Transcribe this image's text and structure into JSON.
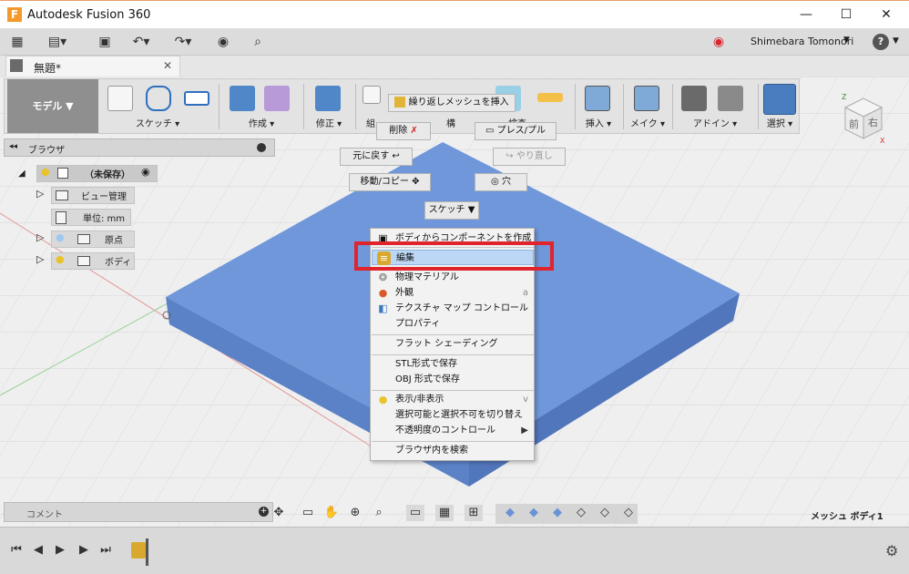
{
  "window": {
    "title": "Autodesk Fusion 360",
    "app_icon_letter": "F",
    "minimize": "—",
    "maximize": "☐",
    "close": "✕"
  },
  "quick_access": {
    "user": "Shimebara Tomonori",
    "help": "?"
  },
  "document_tab": {
    "name": "無題*",
    "close": "✕"
  },
  "ribbon": {
    "workspace": "モデル",
    "groups": [
      "スケッチ",
      "作成",
      "修正",
      "挿入",
      "メイク",
      "アドイン",
      "選択"
    ],
    "partial_labels": [
      "組",
      "構",
      "検査"
    ]
  },
  "browser": {
    "title": "ブラウザ",
    "root": "（未保存）",
    "items": [
      "ビュー管理",
      "単位: mm",
      "原点",
      "ボディ"
    ]
  },
  "mesh_marking_menu": {
    "insert_repeat_mesh": "繰り返しメッシュを挿入",
    "delete": "削除",
    "press_pull": "プレス/プル",
    "undo": "元に戻す",
    "redo": "やり直し",
    "move_copy": "移動/コピー",
    "hole": "穴",
    "sketch": "スケッチ"
  },
  "context_menu": {
    "items": [
      {
        "label": "ボディからコンポーネントを作成",
        "icon": "component-icon"
      },
      {
        "label": "編集",
        "icon": "mesh-edit-icon",
        "highlighted": true
      },
      {
        "label": "物理マテリアル",
        "icon": "material-icon"
      },
      {
        "label": "外観",
        "icon": "appearance-icon",
        "shortcut": "a"
      },
      {
        "label": "テクスチャ マップ コントロール",
        "icon": "texture-icon"
      },
      {
        "label": "プロパティ"
      },
      {
        "label": "フラット シェーディング"
      },
      {
        "label": "STL形式で保存"
      },
      {
        "label": "OBJ 形式で保存"
      },
      {
        "label": "表示/非表示",
        "icon": "bulb-icon",
        "shortcut": "v"
      },
      {
        "label": "選択可能と選択不可を切り替え"
      },
      {
        "label": "不透明度のコントロール",
        "submenu": true
      },
      {
        "label": "ブラウザ内を検索"
      }
    ]
  },
  "view_cube": {
    "front": "前",
    "right": "右",
    "axis_x": "X",
    "axis_z": "Z"
  },
  "comment_bar": {
    "label": "コメント"
  },
  "status": {
    "selection": "メッシュ ボディ1"
  },
  "colors": {
    "mesh": "#6a93d6",
    "highlight": "#bcd7f5",
    "red_box": "#e0242c",
    "accent_bar": "#f39a2b"
  }
}
